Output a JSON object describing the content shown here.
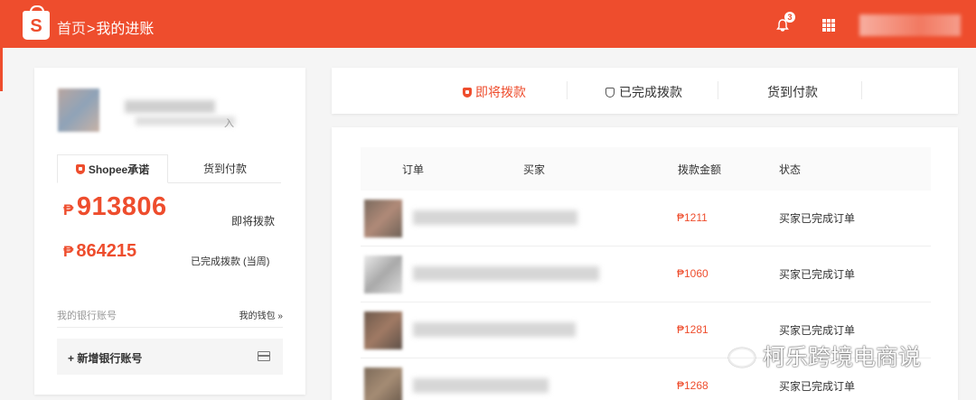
{
  "header": {
    "logo_letter": "S",
    "breadcrumb_home": "首页",
    "breadcrumb_sep": ">",
    "breadcrumb_current": "我的进账",
    "notification_count": "3",
    "icons": [
      "shopee-bag-icon",
      "bell-icon",
      "apps-grid-icon"
    ]
  },
  "left_panel": {
    "name_suffix": "入",
    "tabs": [
      {
        "label": "Shopee承诺",
        "active": true
      },
      {
        "label": "货到付款",
        "active": false
      }
    ],
    "upcoming": {
      "currency": "₱",
      "amount": "913806",
      "label": "即将拨款"
    },
    "completed": {
      "currency": "₱",
      "amount": "864215",
      "label": "已完成拨款 (当周)"
    },
    "bank": {
      "title": "我的银行账号",
      "wallet_link": "我的钱包 »",
      "add_button": "+ 新增银行账号"
    }
  },
  "payout_tabs": [
    {
      "label": "即将拨款",
      "active": true
    },
    {
      "label": "已完成拨款",
      "active": false
    },
    {
      "label": "货到付款",
      "active": false
    }
  ],
  "orders_table": {
    "columns": [
      "订单",
      "买家",
      "拨款金额",
      "状态"
    ],
    "rows": [
      {
        "amount": "₱1211",
        "status": "买家已完成订单"
      },
      {
        "amount": "₱1060",
        "status": "买家已完成订单"
      },
      {
        "amount": "₱1281",
        "status": "买家已完成订单"
      },
      {
        "amount": "₱1268",
        "status": "买家已完成订单"
      }
    ]
  },
  "watermark": "柯乐跨境电商说",
  "colors": {
    "brand": "#ee4d2d",
    "background": "#f5f5f5"
  }
}
